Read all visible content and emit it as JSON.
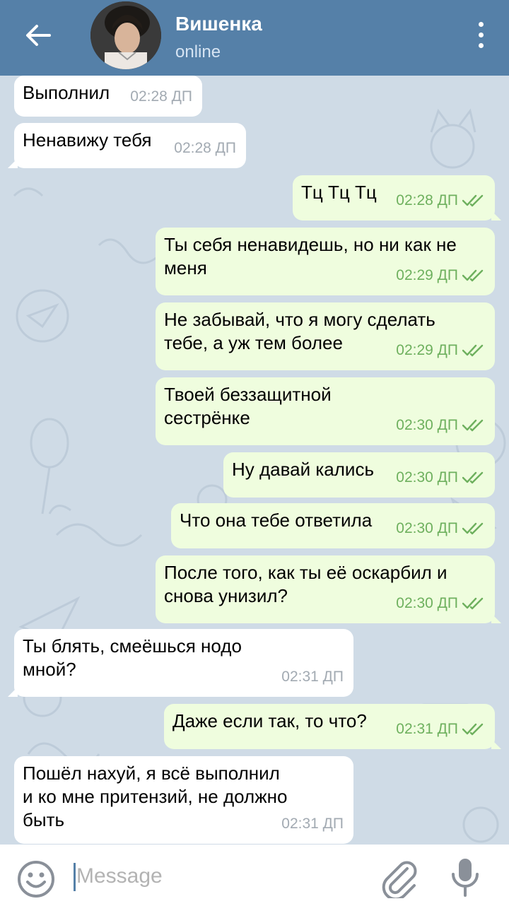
{
  "header": {
    "contact_name": "Вишенка",
    "status": "online"
  },
  "messages": [
    {
      "dir": "in",
      "text": "Выполнил",
      "time": "02:28 ДП"
    },
    {
      "dir": "in",
      "text": "Ненавижу тебя",
      "time": "02:28 ДП"
    },
    {
      "dir": "out",
      "text": "Тц Тц Тц",
      "time": "02:28 ДП",
      "read": true
    },
    {
      "dir": "out",
      "text": "Ты себя ненавидешь, но ни как не\nменя",
      "time": "02:29 ДП",
      "read": true
    },
    {
      "dir": "out",
      "text": "Не забывай, что я могу сделать\nтебе, а уж тем более",
      "time": "02:29 ДП",
      "read": true
    },
    {
      "dir": "out",
      "text": "Твоей беззащитной\nсестрёнке",
      "time": "02:30 ДП",
      "read": true
    },
    {
      "dir": "out",
      "text": "Ну давай кались",
      "time": "02:30 ДП",
      "read": true
    },
    {
      "dir": "out",
      "text": "Что она тебе ответила",
      "time": "02:30 ДП",
      "read": true
    },
    {
      "dir": "out",
      "text": "После того, как ты её оскарбил и\nснова унизил?",
      "time": "02:30 ДП",
      "read": true
    },
    {
      "dir": "in",
      "text": "Ты блять, смеёшься нодо\nмной?",
      "time": "02:31 ДП"
    },
    {
      "dir": "out",
      "text": "Даже если так, то что?",
      "time": "02:31 ДП",
      "read": true
    },
    {
      "dir": "in",
      "text": "Пошёл нахуй, я всё выполнил\nи ко мне притензий, не должно\nбыть",
      "time": "02:31 ДП"
    }
  ],
  "composer": {
    "placeholder": "Message"
  },
  "icons": {
    "back": "arrow-left-icon",
    "menu": "more-vertical-icon",
    "emoji": "smiley-icon",
    "attach": "paperclip-icon",
    "mic": "microphone-icon",
    "read_receipt": "double-check-icon"
  },
  "colors": {
    "header": "#5580a8",
    "incoming_bubble": "#ffffff",
    "outgoing_bubble": "#effdde",
    "outgoing_time": "#6eb05e",
    "chat_background": "#cfdbe6"
  }
}
